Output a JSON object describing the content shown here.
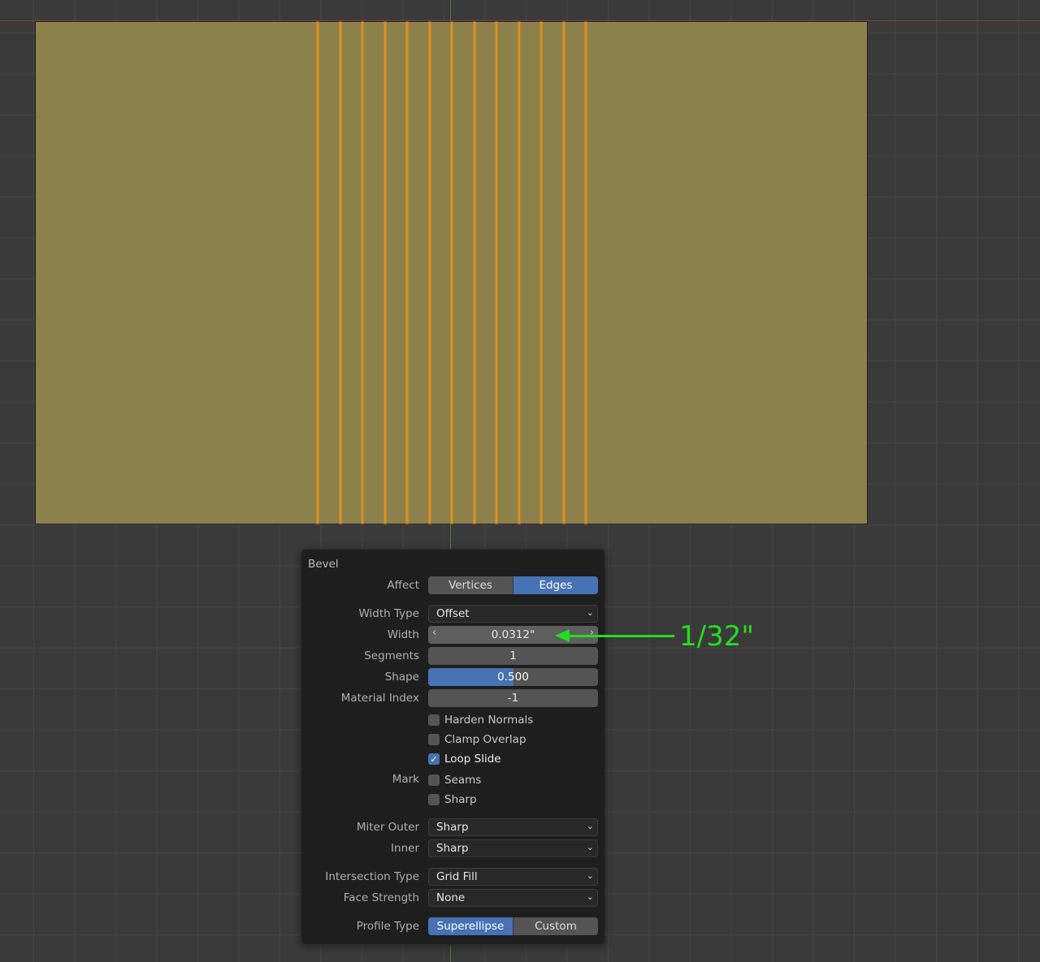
{
  "viewport": {
    "mesh_color": "#8c814b",
    "edge_color": "#e08f1a",
    "selected_edge_count": 13
  },
  "panel": {
    "title": "Bevel",
    "affect": {
      "label": "Affect",
      "options": [
        "Vertices",
        "Edges"
      ],
      "selected": "Edges"
    },
    "width_type": {
      "label": "Width Type",
      "value": "Offset"
    },
    "width": {
      "label": "Width",
      "value": "0.0312\""
    },
    "segments": {
      "label": "Segments",
      "value": "1"
    },
    "shape": {
      "label": "Shape",
      "value": "0.500",
      "fraction": 0.5
    },
    "material_index": {
      "label": "Material Index",
      "value": "-1"
    },
    "harden_normals": {
      "label": "Harden Normals",
      "checked": false
    },
    "clamp_overlap": {
      "label": "Clamp Overlap",
      "checked": false
    },
    "loop_slide": {
      "label": "Loop Slide",
      "checked": true
    },
    "mark": {
      "label": "Mark",
      "seams": {
        "label": "Seams",
        "checked": false
      },
      "sharp": {
        "label": "Sharp",
        "checked": false
      }
    },
    "miter_outer": {
      "label": "Miter Outer",
      "value": "Sharp"
    },
    "miter_inner": {
      "label": "Inner",
      "value": "Sharp"
    },
    "intersection_type": {
      "label": "Intersection Type",
      "value": "Grid Fill"
    },
    "face_strength": {
      "label": "Face Strength",
      "value": "None"
    },
    "profile_type": {
      "label": "Profile Type",
      "options": [
        "Superellipse",
        "Custom"
      ],
      "selected": "Superellipse"
    }
  },
  "annotation": {
    "text": "1/32\"",
    "color": "#22dd22"
  }
}
